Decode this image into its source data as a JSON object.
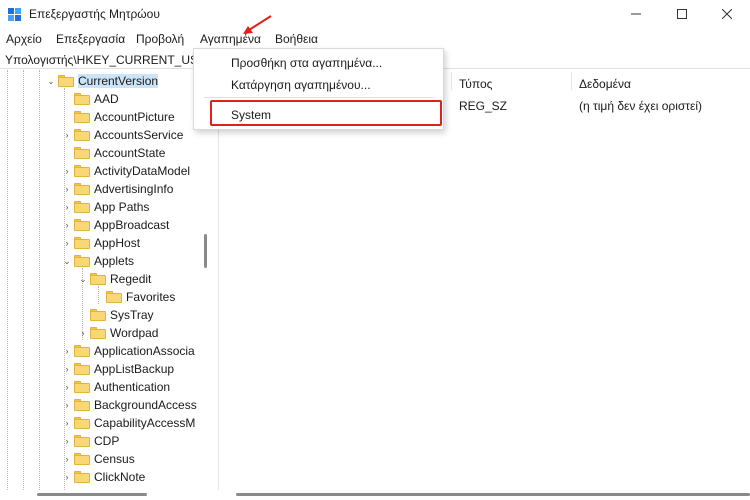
{
  "window": {
    "title": "Επεξεργαστής Μητρώου",
    "minimize_icon": "minimize-icon",
    "maximize_icon": "maximize-icon",
    "close_icon": "close-icon"
  },
  "menu": {
    "items": [
      "Αρχείο",
      "Επεξεργασία",
      "Προβολή",
      "Αγαπημένα",
      "Βοήθεια"
    ]
  },
  "address": {
    "path": "Υπολογιστής\\HKEY_CURRENT_USER\\Software\\Microsoft\\Windows\\CurrentVersion"
  },
  "tree": {
    "items": [
      {
        "label": "CurrentVersion",
        "expanded": true,
        "selected": true
      },
      {
        "label": "AAD"
      },
      {
        "label": "AccountPicture"
      },
      {
        "label": "AccountsService",
        "has_children": true
      },
      {
        "label": "AccountState"
      },
      {
        "label": "ActivityDataModel",
        "has_children": true
      },
      {
        "label": "AdvertisingInfo",
        "has_children": true
      },
      {
        "label": "App Paths",
        "has_children": true
      },
      {
        "label": "AppBroadcast",
        "has_children": true
      },
      {
        "label": "AppHost",
        "has_children": true
      },
      {
        "label": "Applets",
        "expanded": true
      },
      {
        "label": "Regedit",
        "expanded": true
      },
      {
        "label": "Favorites"
      },
      {
        "label": "SysTray"
      },
      {
        "label": "Wordpad",
        "has_children": true
      },
      {
        "label": "ApplicationAssocia",
        "has_children": true
      },
      {
        "label": "AppListBackup",
        "has_children": true
      },
      {
        "label": "Authentication",
        "has_children": true
      },
      {
        "label": "BackgroundAccess",
        "has_children": true
      },
      {
        "label": "CapabilityAccessM",
        "has_children": true
      },
      {
        "label": "CDP",
        "has_children": true
      },
      {
        "label": "Census",
        "has_children": true
      },
      {
        "label": "ClickNote",
        "has_children": true
      }
    ]
  },
  "values_list": {
    "columns": [
      "Τύπος",
      "Δεδομένα"
    ],
    "rows": [
      {
        "type": "REG_SZ",
        "data": "(η τιμή δεν έχει οριστεί)"
      }
    ]
  },
  "favorites_menu": {
    "add_label": "Προσθήκη στα αγαπημένα...",
    "remove_label": "Κατάργηση αγαπημένου...",
    "favorite_item": "System"
  },
  "annotations": {
    "highlight_color": "#e0201b",
    "arrow_color": "#e0201b"
  },
  "colors": {
    "selection": "#cce4f7",
    "folder": "#f8d775"
  }
}
